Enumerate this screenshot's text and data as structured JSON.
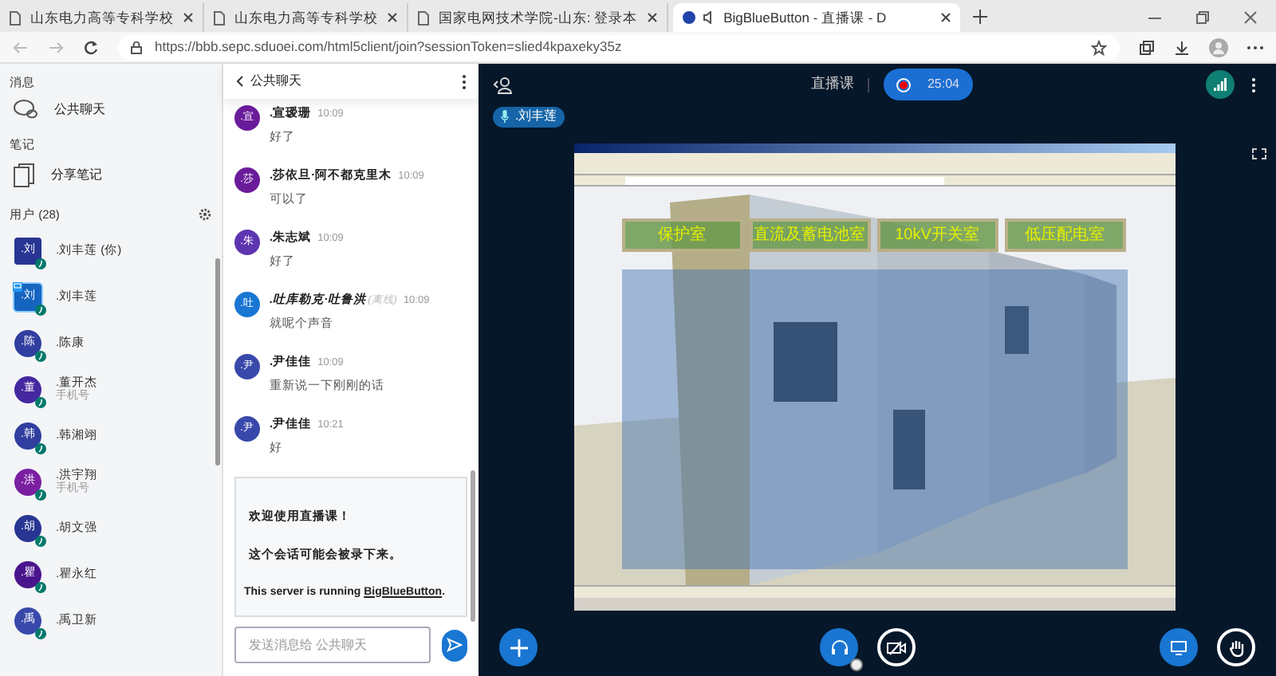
{
  "browser": {
    "tabs": [
      {
        "title": "山东电力高等专科学校",
        "selected": false,
        "audio": false
      },
      {
        "title": "山东电力高等专科学校",
        "selected": false,
        "audio": false
      },
      {
        "title": "国家电网技术学院-山东: 登录本",
        "selected": false,
        "audio": false
      },
      {
        "title": "BigBlueButton - 直播课 - D",
        "selected": true,
        "audio": true
      }
    ],
    "url": "https://bbb.sepc.sduoei.com/html5client/join?sessionToken=slied4kpaxeky35z"
  },
  "sidebar": {
    "messages_heading": "消息",
    "public_chat": "公共聊天",
    "notes_heading": "笔记",
    "shared_notes": "分享笔记",
    "users_heading": "用户 (28)",
    "users": [
      {
        "avatar": ".刘",
        "name": ".刘丰莲 (你)",
        "kind": "moderator",
        "presenter": false,
        "color": "#283593"
      },
      {
        "avatar": ".刘",
        "name": ".刘丰莲",
        "kind": "moderator",
        "presenter": true,
        "color": "#1565c0"
      },
      {
        "avatar": ".陈",
        "name": ".陈康",
        "kind": "viewer",
        "presenter": false,
        "color": "#303f9f"
      },
      {
        "avatar": ".董",
        "name": ".董开杰",
        "subtitle": "手机号",
        "kind": "viewer",
        "presenter": false,
        "color": "#4527a0"
      },
      {
        "avatar": ".韩",
        "name": ".韩湘翊",
        "kind": "viewer",
        "presenter": false,
        "color": "#303f9f"
      },
      {
        "avatar": ".洪",
        "name": ".洪宇翔",
        "subtitle": "手机号",
        "kind": "viewer",
        "presenter": false,
        "color": "#7b1fa2"
      },
      {
        "avatar": ".胡",
        "name": ".胡文强",
        "kind": "viewer",
        "presenter": false,
        "color": "#283593"
      },
      {
        "avatar": ".瞿",
        "name": ".瞿永红",
        "kind": "viewer",
        "presenter": false,
        "color": "#4a148c"
      },
      {
        "avatar": ".禹",
        "name": ".禹卫新",
        "kind": "viewer",
        "presenter": false,
        "color": "#3949ab"
      }
    ]
  },
  "chat": {
    "title": "公共聊天",
    "messages": [
      {
        "avatar": ".宣",
        "name": ".宣瑷珊",
        "time": "10:09",
        "text": "好了",
        "offline": false,
        "color": "#6a1b9a"
      },
      {
        "avatar": ".莎",
        "name": ".莎依旦·阿不都克里木",
        "time": "10:09",
        "text": "可以了",
        "offline": false,
        "color": "#6a1b9a"
      },
      {
        "avatar": ".朱",
        "name": ".朱志斌",
        "time": "10:09",
        "text": "好了",
        "offline": false,
        "color": "#5e35b1"
      },
      {
        "avatar": ".吐",
        "name": ".吐库勒克·吐鲁洪",
        "status": "(离线)",
        "time": "10:09",
        "text": "就呢个声音",
        "offline": true,
        "color": "#1976d2"
      },
      {
        "avatar": ".尹",
        "name": ".尹佳佳",
        "time": "10:09",
        "text": "重新说一下刚刚的话",
        "offline": false,
        "color": "#3949ab"
      },
      {
        "avatar": ".尹",
        "name": ".尹佳佳",
        "time": "10:21",
        "text": "好",
        "offline": false,
        "color": "#3949ab"
      }
    ],
    "welcome": [
      "欢迎使用直播课！",
      "这个会话可能会被录下来。"
    ],
    "server_text": "This server is running ",
    "server_link": "BigBlueButton",
    "server_end": ".",
    "placeholder": "发送消息给 公共聊天"
  },
  "session": {
    "title": "直播课",
    "recording": true,
    "timer": "25:04",
    "talker": ".刘丰莲"
  },
  "presentation": {
    "rooms": [
      "保护室",
      "直流及蓄电池室",
      "10kV开关室",
      "低压配电室"
    ]
  },
  "controls": {
    "audio_joined": true,
    "camera_on": false
  }
}
